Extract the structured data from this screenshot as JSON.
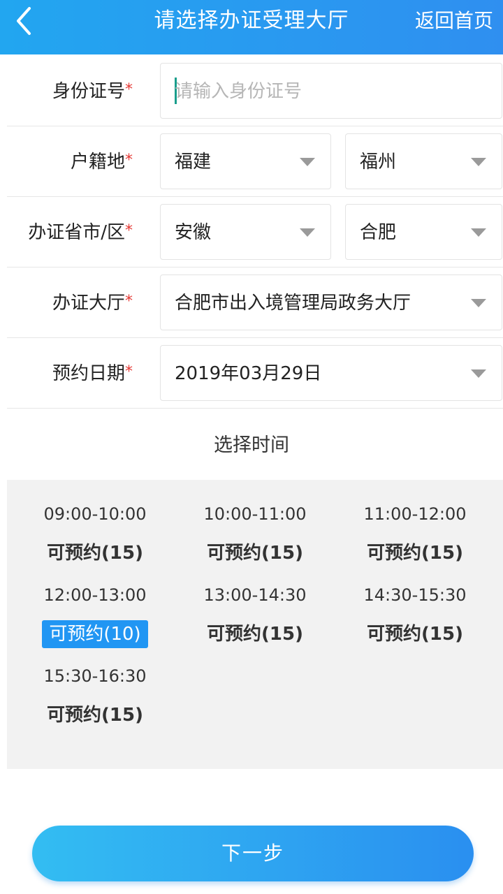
{
  "header": {
    "back_icon": "chevron-left-icon",
    "title": "请选择办证受理大厅",
    "home_link": "返回首页",
    "color_start": "#22a6f0",
    "color_end": "#2f8ff0"
  },
  "form": {
    "required_mark": "*",
    "id_number": {
      "label": "身份证号",
      "placeholder": "请输入身份证号",
      "value": ""
    },
    "household": {
      "label": "户籍地",
      "province": "福建",
      "city": "福州"
    },
    "office_region": {
      "label": "办证省市/区",
      "province": "安徽",
      "city": "合肥"
    },
    "office_hall": {
      "label": "办证大厅",
      "value": "合肥市出入境管理局政务大厅"
    },
    "appointment_date": {
      "label": "预约日期",
      "value": "2019年03月29日"
    }
  },
  "time_section": {
    "title": "选择时间",
    "slots": [
      {
        "time": "09:00-10:00",
        "status": "可预约(15)",
        "selected": false
      },
      {
        "time": "10:00-11:00",
        "status": "可预约(15)",
        "selected": false
      },
      {
        "time": "11:00-12:00",
        "status": "可预约(15)",
        "selected": false
      },
      {
        "time": "12:00-13:00",
        "status": "可预约(10)",
        "selected": true
      },
      {
        "time": "13:00-14:30",
        "status": "可预约(15)",
        "selected": false
      },
      {
        "time": "14:30-15:30",
        "status": "可预约(15)",
        "selected": false
      },
      {
        "time": "15:30-16:30",
        "status": "可预约(15)",
        "selected": false
      }
    ],
    "selected_color": "#2196f3"
  },
  "next_button": {
    "label": "下一步"
  },
  "required_color": "#e53935"
}
